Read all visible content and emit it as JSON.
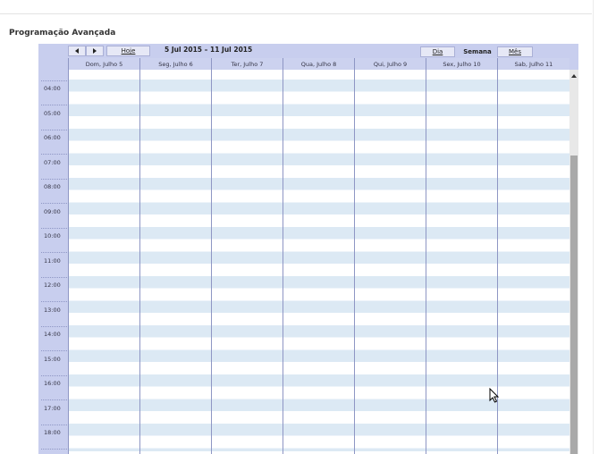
{
  "page": {
    "title": "Programação Avançada"
  },
  "calendar": {
    "nav": {
      "prev_icon": "prev-arrow-icon",
      "next_icon": "next-arrow-icon",
      "today_label": "Hoje"
    },
    "date_range": "5 Jul 2015 – 11 Jul 2015",
    "views": {
      "day": "Dia",
      "week": "Semana",
      "month": "Mês",
      "active": "week"
    },
    "days": [
      "Dom, Julho 5",
      "Seg, Julho 6",
      "Ter, Julho 7",
      "Qua, Julho 8",
      "Qui, Julho 9",
      "Sex, Julho 10",
      "Sab, Julho 11"
    ],
    "times": [
      "04:00",
      "05:00",
      "06:00",
      "07:00",
      "08:00",
      "09:00",
      "10:00",
      "11:00",
      "12:00",
      "13:00",
      "14:00",
      "15:00",
      "16:00",
      "17:00",
      "18:00"
    ],
    "colors": {
      "chrome": "#c8ceee",
      "stripe": "#dce9f4",
      "line": "#8e96c4"
    }
  }
}
